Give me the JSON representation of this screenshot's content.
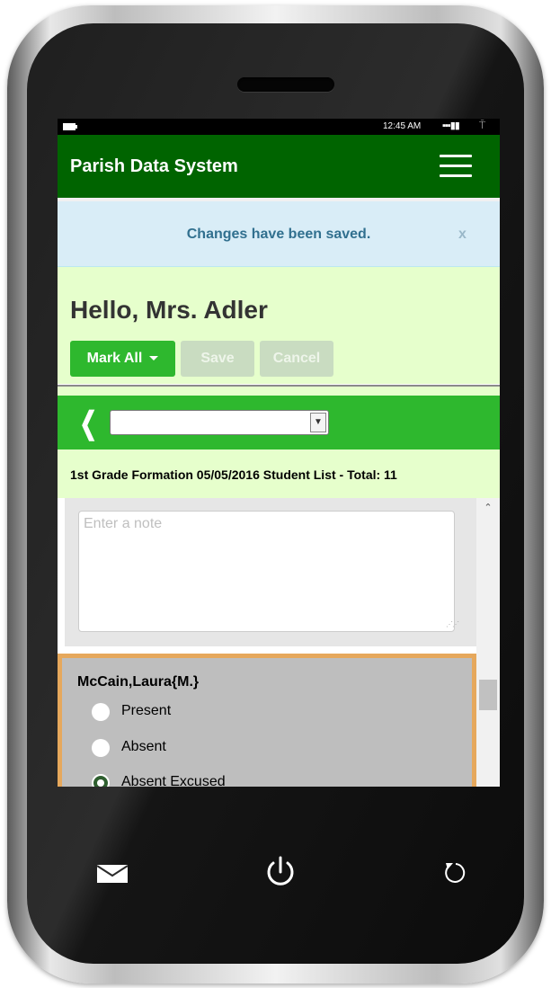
{
  "status_bar": {
    "time": "12:45 AM",
    "signal_icon": "signal-bars-icon",
    "battery_icon": "battery-icon",
    "wifi_icon": "wifi-icon"
  },
  "header": {
    "title": "Parish Data System",
    "menu_icon": "hamburger-menu-icon",
    "background_color": "#006400"
  },
  "alert": {
    "message": "Changes have been saved.",
    "close_label": "x"
  },
  "greeting": {
    "text": "Hello, Mrs. Adler"
  },
  "toolbar": {
    "mark_all_label": "Mark All",
    "save_label": "Save",
    "cancel_label": "Cancel",
    "accent_color": "#2eb82e"
  },
  "navigation": {
    "back_icon": "chevron-left-icon",
    "date_select_value": ""
  },
  "list": {
    "header": "1st Grade Formation 05/05/2016 Student List - Total: 11",
    "note_placeholder": "Enter a note",
    "student": {
      "name": "McCain,Laura{M.}",
      "options": [
        "Present",
        "Absent",
        "Absent Excused"
      ],
      "selected": "Absent Excused",
      "highlight_color": "#e6a85c"
    }
  },
  "device_buttons": {
    "left": "mail-icon",
    "center": "power-icon",
    "right": "refresh-back-icon"
  }
}
